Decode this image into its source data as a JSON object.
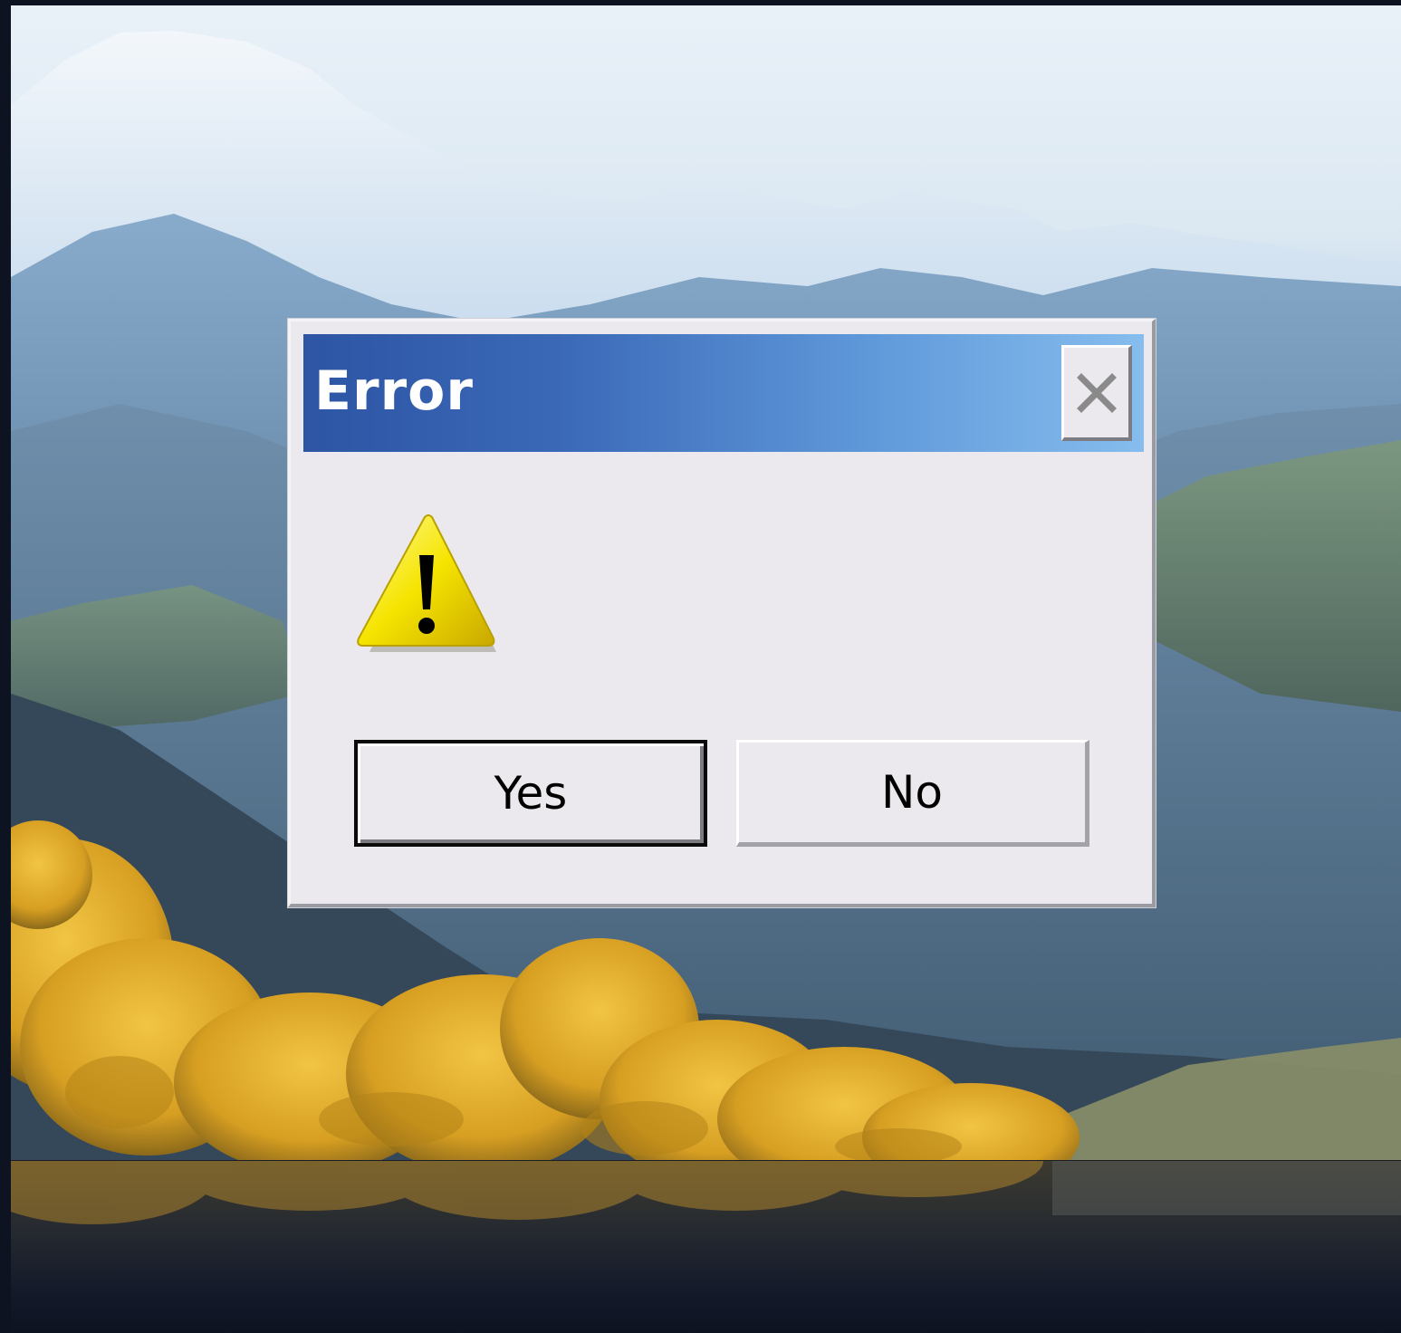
{
  "dialog": {
    "title": "Error",
    "close_icon": "close-x-icon",
    "message_icon": "warning-icon",
    "buttons": {
      "yes_label": "Yes",
      "no_label": "No"
    }
  },
  "colors": {
    "titlebar_start": "#2d55a4",
    "titlebar_end": "#86bdee",
    "dialog_face": "#ebe9ee",
    "warning_yellow": "#f5e400"
  }
}
